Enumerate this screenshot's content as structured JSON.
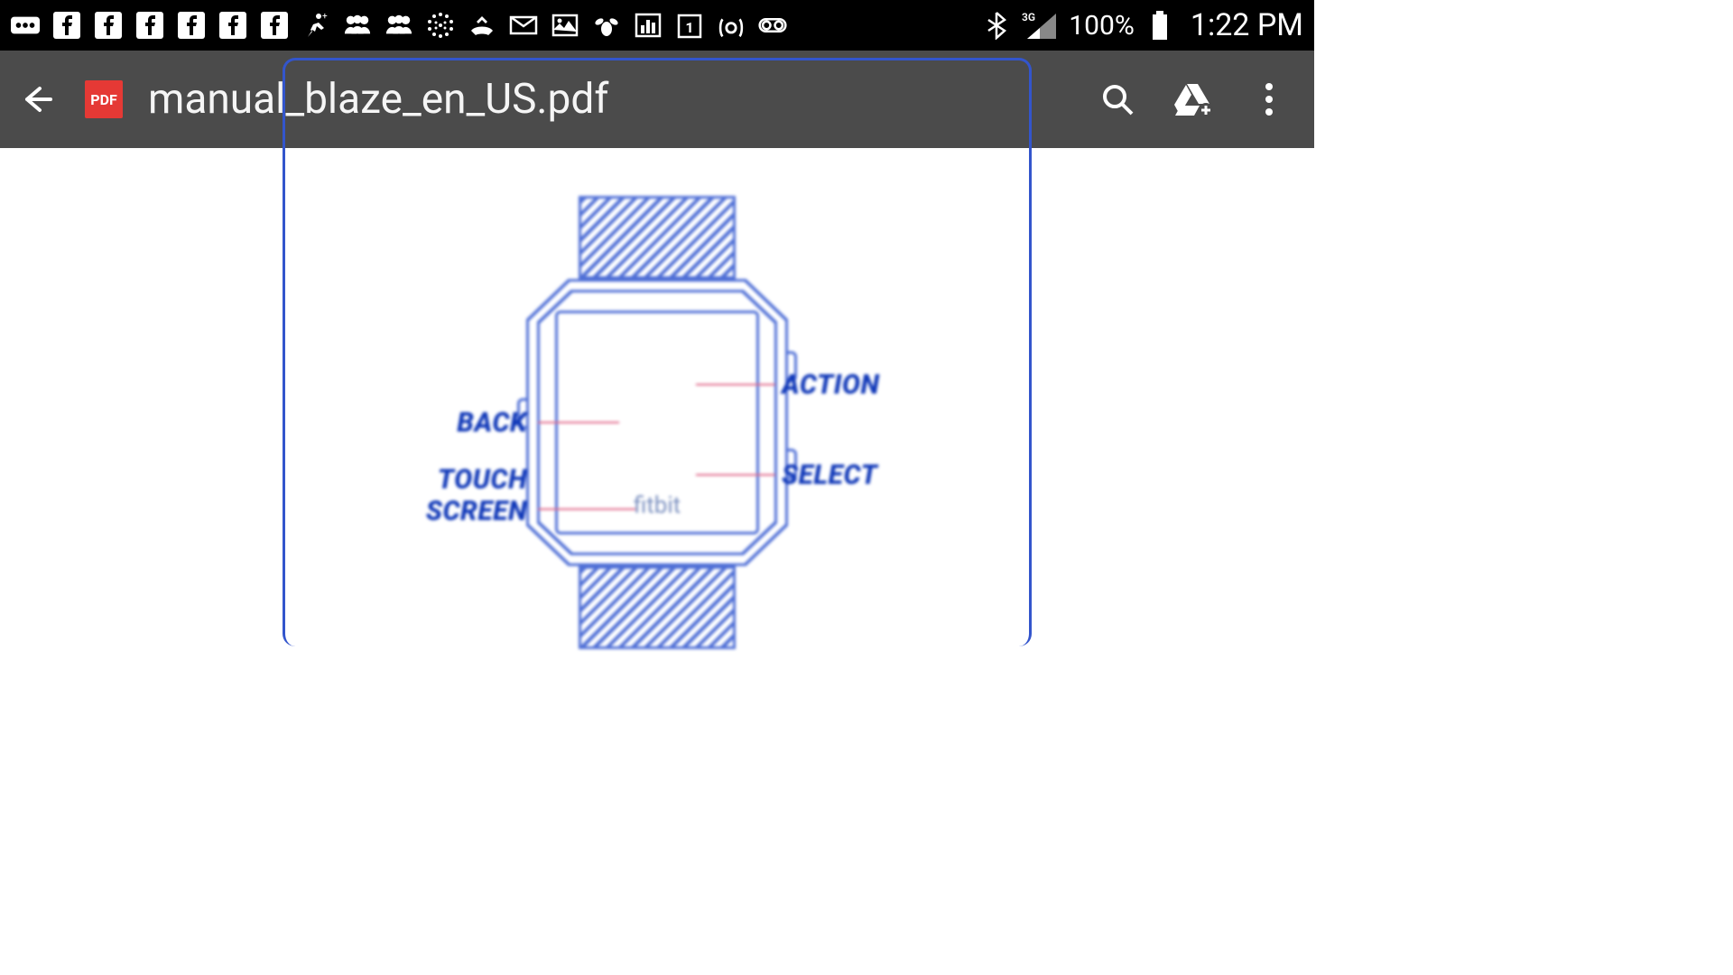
{
  "status": {
    "battery_pct": "100%",
    "time": "1:22 PM",
    "network": "3G"
  },
  "appbar": {
    "pdf_badge": "PDF",
    "title": "manual_blaze_en_US.pdf"
  },
  "diagram": {
    "brand": "fitbit",
    "labels": {
      "back": "BACK",
      "touch_line1": "TOUCH",
      "touch_line2": "SCREEN",
      "action": "ACTION",
      "select": "SELECT"
    }
  }
}
